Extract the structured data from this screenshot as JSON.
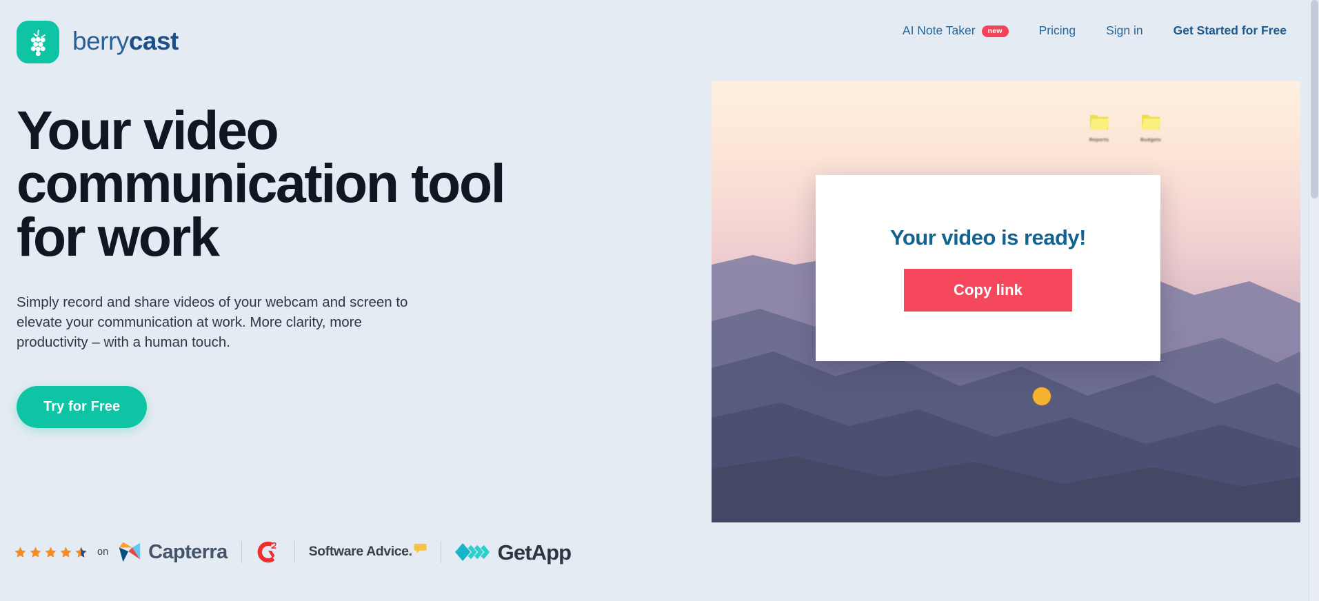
{
  "brand": {
    "name": "berrycast",
    "name_light": "berry",
    "name_bold": "cast",
    "logo_icon": "grape-cluster-icon",
    "logo_bg_color": "#0EC4A4"
  },
  "nav": {
    "items": [
      {
        "label": "AI Note Taker",
        "badge": "new",
        "badge_color": "#F3455A",
        "emphasis": false
      },
      {
        "label": "Pricing",
        "badge": null,
        "emphasis": false
      },
      {
        "label": "Sign in",
        "badge": null,
        "emphasis": false
      },
      {
        "label": "Get Started for Free",
        "badge": null,
        "emphasis": true
      }
    ],
    "link_color": "#23679F"
  },
  "hero": {
    "headline": "Your video communication tool for work",
    "subhead": "Simply record and share videos of your webcam and screen to elevate your communication at work. More clarity, more productivity – with a human touch.",
    "cta_label": "Try for Free",
    "cta_color": "#0EC4A4"
  },
  "reviews": {
    "rating": 4.5,
    "stars_total": 5,
    "star_color": "#F68B23",
    "on_label": "on",
    "platforms": [
      {
        "name": "Capterra",
        "icon": "capterra-logo-icon"
      },
      {
        "name": "G2",
        "icon": "g2-logo-icon"
      },
      {
        "name": "Software Advice.",
        "icon": "software-advice-logo-icon"
      },
      {
        "name": "GetApp",
        "icon": "getapp-logo-icon"
      }
    ]
  },
  "hero_media": {
    "alt": "Screen recording preview over mountain sunset wallpaper",
    "card_title": "Your video is ready!",
    "card_button_label": "Copy link",
    "card_button_color": "#F5485D",
    "card_title_color": "#14628F",
    "desktop_folders": [
      {
        "label": "Reports",
        "icon": "folder-icon"
      },
      {
        "label": "Budgets",
        "icon": "folder-icon"
      }
    ],
    "cursor_highlight_color": "#F6B332"
  },
  "page": {
    "background_color": "#E5EBF2"
  }
}
